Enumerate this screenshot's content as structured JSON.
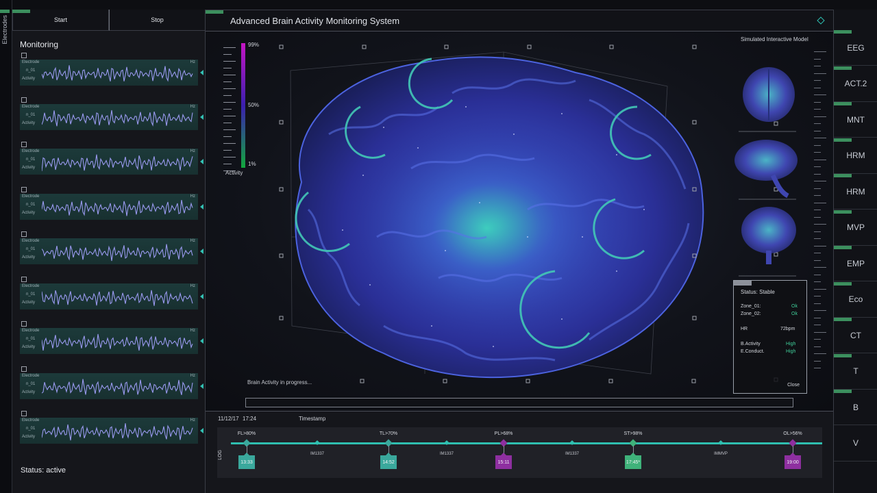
{
  "sidebar_strip": {
    "label": "Electrodes"
  },
  "top_buttons": {
    "start": "Start",
    "stop": "Stop"
  },
  "monitoring": {
    "title": "Monitoring",
    "channel_labels": {
      "electrode": "Electrode",
      "id": "n_01",
      "activity": "Activity",
      "unit": "Hz"
    },
    "channel_count": 9,
    "status": "Status: active"
  },
  "main": {
    "title": "Advanced Brain Activity Monitoring System",
    "scale": {
      "top": "99%",
      "mid": "50%",
      "bottom": "1%",
      "caption": "Activity"
    },
    "sim_label": "Simulated Interactive Model",
    "progress_label": "Brain Activity in progress...",
    "status_popup": {
      "title": "Status: Stable",
      "zone1_label": "Zone_01:",
      "zone1_value": "Ok",
      "zone2_label": "Zone_02:",
      "zone2_value": "Ok",
      "hr_label": "HR",
      "hr_value": "72bpm",
      "bactivity_label": "B.Activity",
      "bactivity_value": "High",
      "econduct_label": "E.Conduct.",
      "econduct_value": "High",
      "close": "Close"
    }
  },
  "timeline": {
    "date": "11/12/17",
    "time": "17:24",
    "timestamp_label": "Timestamp",
    "log_label": "LOG",
    "events": [
      {
        "top": "FL>80%",
        "badge": "13:33",
        "color": "#3aa89c"
      },
      {
        "top": "TL>70%",
        "badge": "14:52",
        "color": "#3aa89c"
      },
      {
        "top": "PL>68%",
        "badge": "15:11",
        "color": "#8e2fa0"
      },
      {
        "top": "ST>98%",
        "badge": "17:45*",
        "color": "#3fb27a"
      },
      {
        "top": "OL>56%",
        "badge": "19:00",
        "color": "#8e2fa0"
      }
    ],
    "mid_labels": [
      "IM1337",
      "IM1337",
      "IM1337",
      "IMMVP"
    ]
  },
  "nav": [
    "EEG",
    "ACT.2",
    "MNT",
    "HRM",
    "HRM",
    "MVP",
    "EMP",
    "Eco",
    "CT",
    "T",
    "B",
    "V"
  ],
  "colors": {
    "accent": "#2fc3b4",
    "green_tab": "#3c8f5e",
    "brain": "#3a4fd0",
    "purple": "#8e2fa0"
  }
}
